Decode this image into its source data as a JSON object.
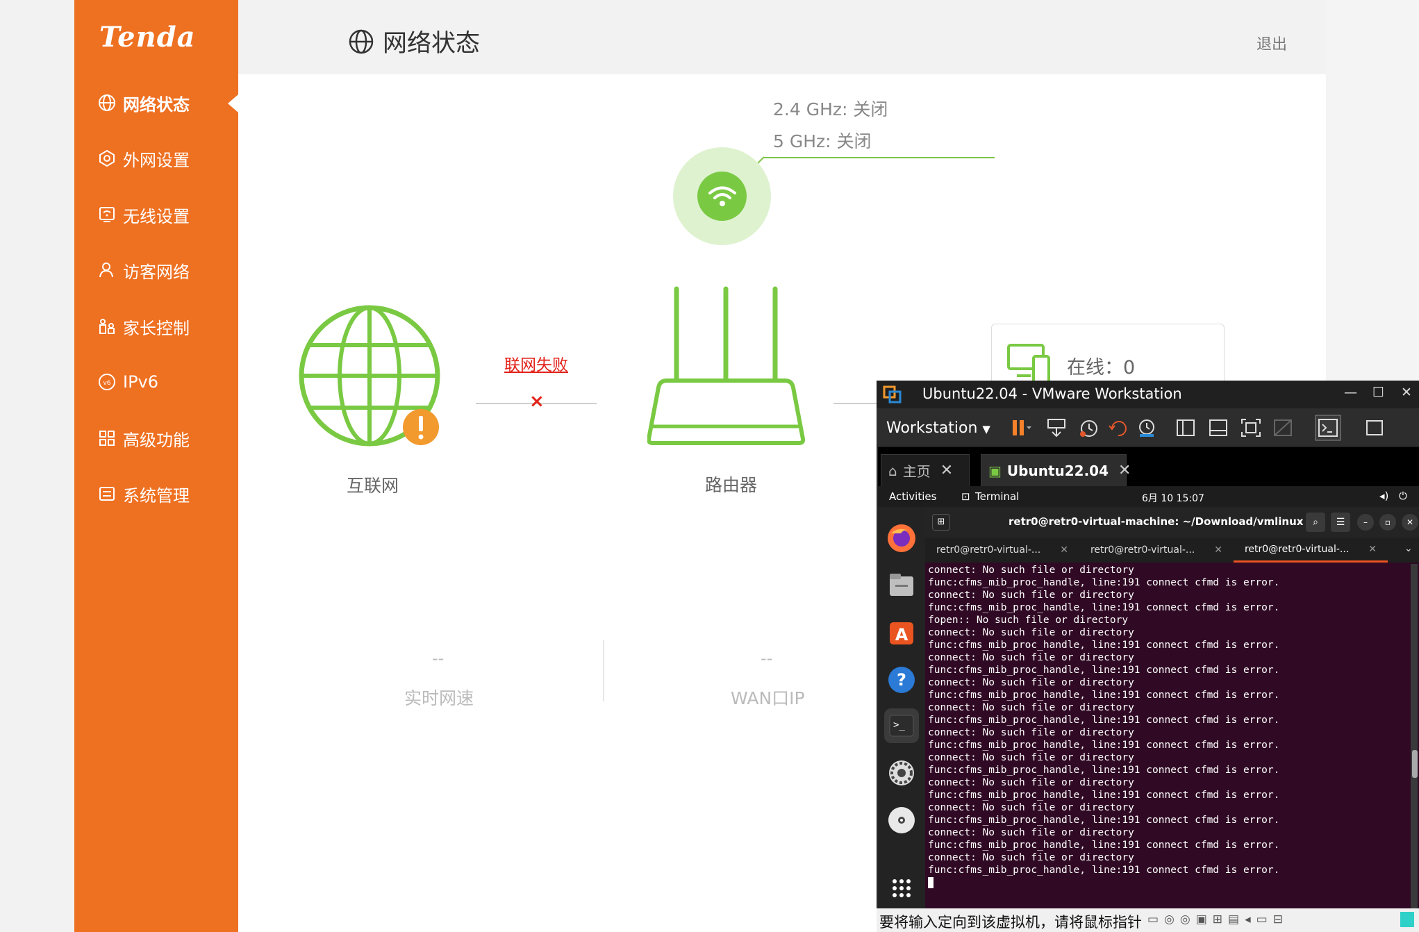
{
  "router": {
    "brand": "Tenda",
    "page_title": "网络状态",
    "logout": "退出",
    "nav": [
      {
        "label": "网络状态",
        "icon": "globe-icon"
      },
      {
        "label": "外网设置",
        "icon": "wan-icon"
      },
      {
        "label": "无线设置",
        "icon": "wifi-settings-icon"
      },
      {
        "label": "访客网络",
        "icon": "guest-icon"
      },
      {
        "label": "家长控制",
        "icon": "parental-icon"
      },
      {
        "label": "IPv6",
        "icon": "ipv6-icon"
      },
      {
        "label": "高级功能",
        "icon": "grid-icon"
      },
      {
        "label": "系统管理",
        "icon": "system-icon"
      }
    ],
    "wifi_24": "2.4 GHz: 关闭",
    "wifi_5": "5 GHz: 关闭",
    "internet_label": "互联网",
    "router_label": "路由器",
    "link_status": "联网失败",
    "online": "在线：0",
    "speed_value": "--",
    "speed_label": "实时网速",
    "wan_value": "--",
    "wan_label": "WAN口IP",
    "colors": {
      "brand": "#ee7021",
      "ok": "#7ac943",
      "error": "#e2231a",
      "warning": "#f29a2e"
    }
  },
  "vmware": {
    "title": "Ubuntu22.04 - VMware Workstation",
    "menu_label": "Workstation",
    "tabs": [
      {
        "label": "主页",
        "active": false
      },
      {
        "label": "Ubuntu22.04",
        "active": true
      }
    ],
    "status_text": "要将输入定向到该虚拟机，请将鼠标指针",
    "ubuntu": {
      "activities": "Activities",
      "app": "Terminal",
      "clock": "6月 10  15:07",
      "terminal_title": "retr0@retr0-virtual-machine: ~/Download/vmlinux",
      "term_tabs": [
        "retr0@retr0-virtual-...",
        "retr0@retr0-virtual-...",
        "retr0@retr0-virtual-..."
      ],
      "lines": [
        "connect: No such file or directory",
        "func:cfms_mib_proc_handle, line:191 connect cfmd is error.",
        "connect: No such file or directory",
        "func:cfms_mib_proc_handle, line:191 connect cfmd is error.",
        "fopen:: No such file or directory",
        "connect: No such file or directory",
        "func:cfms_mib_proc_handle, line:191 connect cfmd is error.",
        "connect: No such file or directory",
        "func:cfms_mib_proc_handle, line:191 connect cfmd is error.",
        "connect: No such file or directory",
        "func:cfms_mib_proc_handle, line:191 connect cfmd is error.",
        "connect: No such file or directory",
        "func:cfms_mib_proc_handle, line:191 connect cfmd is error.",
        "connect: No such file or directory",
        "func:cfms_mib_proc_handle, line:191 connect cfmd is error.",
        "connect: No such file or directory",
        "func:cfms_mib_proc_handle, line:191 connect cfmd is error.",
        "connect: No such file or directory",
        "func:cfms_mib_proc_handle, line:191 connect cfmd is error.",
        "connect: No such file or directory",
        "func:cfms_mib_proc_handle, line:191 connect cfmd is error.",
        "connect: No such file or directory",
        "func:cfms_mib_proc_handle, line:191 connect cfmd is error.",
        "connect: No such file or directory",
        "func:cfms_mib_proc_handle, line:191 connect cfmd is error."
      ]
    }
  }
}
